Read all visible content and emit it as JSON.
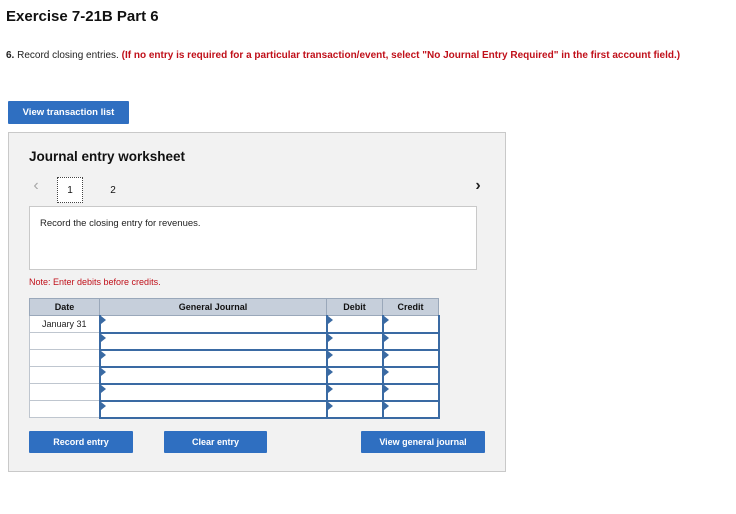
{
  "page": {
    "title": "Exercise 7-21B Part 6"
  },
  "instructions": {
    "number": "6.",
    "text": " Record closing entries. ",
    "note": "(If no entry is required for a particular transaction/event, select \"No Journal Entry Required\" in the first account field.)"
  },
  "buttons": {
    "view_transactions": "View transaction list",
    "record_entry": "Record entry",
    "clear_entry": "Clear entry",
    "view_general_journal": "View general journal"
  },
  "worksheet": {
    "title": "Journal entry worksheet",
    "prev_icon": "chevron-left-icon",
    "next_icon": "chevron-right-icon",
    "pages": [
      "1",
      "2"
    ],
    "active_page": "1",
    "prompt": "Record the closing entry for revenues.",
    "note": "Note: Enter debits before credits."
  },
  "journal": {
    "columns": [
      "Date",
      "General Journal",
      "Debit",
      "Credit"
    ],
    "rows": [
      {
        "date": "January 31",
        "account": "",
        "debit": "",
        "credit": ""
      },
      {
        "date": "",
        "account": "",
        "debit": "",
        "credit": ""
      },
      {
        "date": "",
        "account": "",
        "debit": "",
        "credit": ""
      },
      {
        "date": "",
        "account": "",
        "debit": "",
        "credit": ""
      },
      {
        "date": "",
        "account": "",
        "debit": "",
        "credit": ""
      },
      {
        "date": "",
        "account": "",
        "debit": "",
        "credit": ""
      }
    ]
  },
  "colors": {
    "primary_button": "#2f6fc1",
    "instruction_red": "#c0101a",
    "table_header": "#c6cfdb",
    "input_border": "#3a6aa3"
  }
}
